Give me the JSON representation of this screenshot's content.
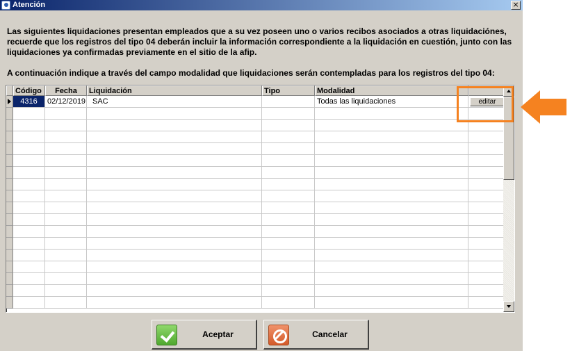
{
  "window": {
    "title": "Atención",
    "close_glyph": "×"
  },
  "message": "Las siguientes liquidaciones presentan empleados que a su vez poseen uno o varios recibos asociados a otras liquidaciónes, recuerde que los registros del tipo 04 deberán incluir la información correspondiente a la liquidación en cuestión, junto con las liquidaciones ya confirmadas previamente en el sitio de la afip.",
  "instruction": "A continuación indique a través del campo modalidad que liquidaciones serán contempladas para los registros del tipo 04:",
  "table": {
    "columns": [
      "Código",
      "Fecha",
      "Liquidación",
      "Tipo",
      "Modalidad"
    ],
    "rows": [
      {
        "codigo": "4316",
        "fecha": "02/12/2019",
        "liquidacion": "SAC",
        "tipo": "",
        "modalidad": "Todas las liquidaciones",
        "action_label": "editar"
      }
    ]
  },
  "buttons": {
    "accept_label": "Aceptar",
    "cancel_label": "Cancelar"
  },
  "colors": {
    "annotation": "#f58220",
    "selection": "#0a246a",
    "titlebar": "#0a246a"
  },
  "icons": {
    "title": "app-icon",
    "accept": "check-icon",
    "cancel": "cancel-icon"
  }
}
